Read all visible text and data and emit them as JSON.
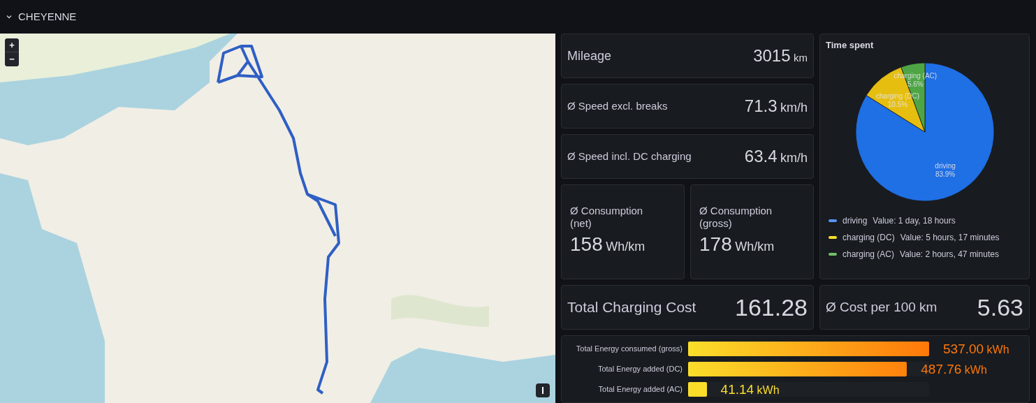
{
  "row_header": {
    "title": "CHEYENNE",
    "expanded": true
  },
  "map": {
    "zoom_in": "+",
    "zoom_out": "−"
  },
  "stats": [
    {
      "label": "Mileage",
      "value": "3015",
      "unit": "km"
    },
    {
      "label": "Ø Speed excl. breaks",
      "value": "71.3",
      "unit": "km/h"
    },
    {
      "label": "Ø Speed incl. DC charging",
      "value": "63.4",
      "unit": "km/h"
    }
  ],
  "consumption": [
    {
      "label": "Ø Consumption (net)",
      "value": "158",
      "unit": "Wh/km"
    },
    {
      "label": "Ø Consumption (gross)",
      "value": "178",
      "unit": "Wh/km"
    }
  ],
  "costs": [
    {
      "label": "Total Charging Cost",
      "value": "161.28"
    },
    {
      "label": "Ø Cost per 100 km",
      "value": "5.63"
    }
  ],
  "time_spent": {
    "title": "Time spent",
    "chart_data": {
      "type": "pie",
      "categories": [
        "driving",
        "charging (DC)",
        "charging (AC)"
      ],
      "values": [
        83.9,
        10.5,
        5.6
      ],
      "colors": [
        "#1f6fe5",
        "#e6be0f",
        "#4ea545"
      ],
      "value_labels": [
        "83.9%",
        "10.5%",
        "5.6%"
      ]
    },
    "legend": [
      {
        "name": "driving",
        "value": "Value: 1 day, 18 hours",
        "color": "#5794f2"
      },
      {
        "name": "charging (DC)",
        "value": "Value: 5 hours, 17 minutes",
        "color": "#fade2a"
      },
      {
        "name": "charging (AC)",
        "value": "Value: 2 hours, 47 minutes",
        "color": "#73bf69"
      }
    ]
  },
  "energy": [
    {
      "label": "Total Energy consumed (gross)",
      "value": "537.00",
      "unit": "kWh",
      "level": 1.0,
      "color": "#ff780a"
    },
    {
      "label": "Total Energy added (DC)",
      "value": "487.76",
      "unit": "kWh",
      "level": 0.908,
      "color": "#ff780a"
    },
    {
      "label": "Total Energy added (AC)",
      "value": "41.14",
      "unit": "kWh",
      "level": 0.077,
      "color": "#fade2a"
    }
  ]
}
